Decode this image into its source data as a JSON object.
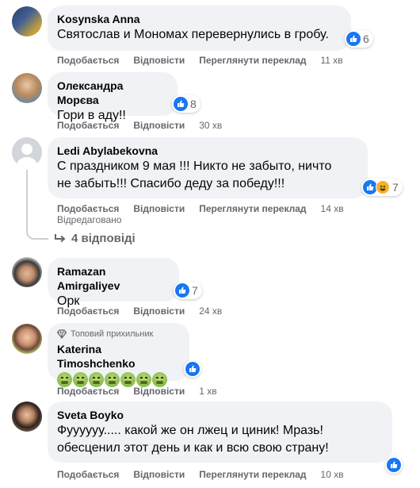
{
  "comments": [
    {
      "author": "Kosynska Anna",
      "text": "Святослав и Мономах перевернулись в гробу.",
      "reactions": "6",
      "like": "Подобається",
      "reply": "Відповісти",
      "translate": "Переглянути переклад",
      "time": "11 хв"
    },
    {
      "author": "Олександра Морєва",
      "text": "Гори в аду!!",
      "reactions": "8",
      "like": "Подобається",
      "reply": "Відповісти",
      "time": "30 хв"
    },
    {
      "author": "Ledi Abylabekovna",
      "text_line1": "С праздником 9 мая !!! Никто не забыто, ничто",
      "text_line2": "не забыть!!! Спасибо деду за победу!!!",
      "reactions": "7",
      "like": "Подобається",
      "reply": "Відповісти",
      "translate": "Переглянути переклад",
      "time": "14 хв",
      "edited": "Відредаговано",
      "replies": "4 відповіді"
    },
    {
      "author": "Ramazan Amirgaliyev",
      "text": "Орк",
      "reactions": "7",
      "like": "Подобається",
      "reply": "Відповісти",
      "time": "24 хв"
    },
    {
      "badge": "Топовий прихильник",
      "author": "Katerina Timoshchenko",
      "emoji_count": 7,
      "like": "Подобається",
      "reply": "Відповісти",
      "time": "1 хв"
    },
    {
      "author": "Sveta Boyko",
      "text_line1": "Фуууууу..... какой же он лжец и циник! Мразь!",
      "text_line2": "обесценил этот день и как и всю свою страну!",
      "like": "Подобається",
      "reply": "Відповісти",
      "translate": "Переглянути переклад",
      "time": "10 хв"
    }
  ],
  "colors": {
    "accent": "#1877f2",
    "bubble": "#f0f2f5",
    "meta": "#65676b"
  },
  "icons": [
    "like-icon",
    "haha-icon",
    "reply-arrow-icon",
    "diamond-icon",
    "nauseated-face-icon"
  ]
}
